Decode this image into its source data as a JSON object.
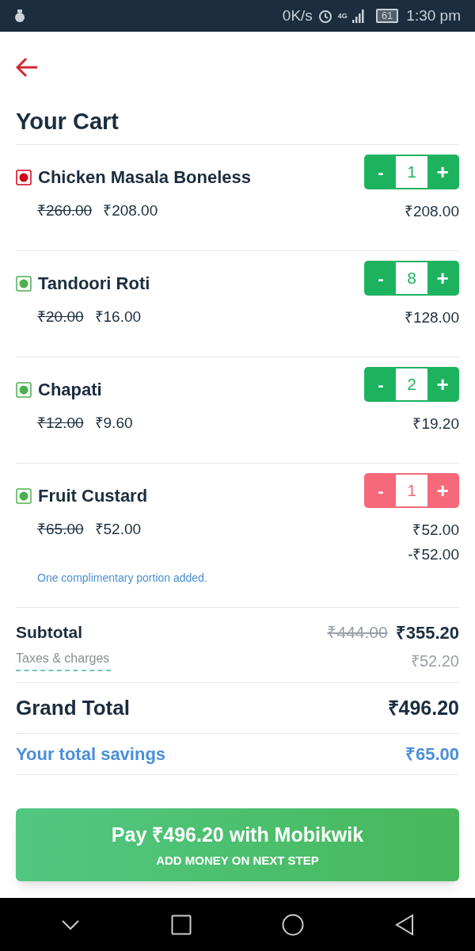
{
  "status_bar": {
    "speed": "0K/s",
    "network": "4G",
    "battery": "61",
    "time": "1:30 pm"
  },
  "title": "Your Cart",
  "items": [
    {
      "name": "Chicken Masala Boneless",
      "kind": "nonveg",
      "original_price": "₹260.00",
      "price": "₹208.00",
      "minus": "-",
      "quantity": "1",
      "plus": "+",
      "total": "₹208.00",
      "complimentary": false
    },
    {
      "name": "Tandoori Roti",
      "kind": "veg",
      "original_price": "₹20.00",
      "price": "₹16.00",
      "minus": "-",
      "quantity": "8",
      "plus": "+",
      "total": "₹128.00",
      "complimentary": false
    },
    {
      "name": "Chapati",
      "kind": "veg",
      "original_price": "₹12.00",
      "price": "₹9.60",
      "minus": "-",
      "quantity": "2",
      "plus": "+",
      "total": "₹19.20",
      "complimentary": false
    },
    {
      "name": "Fruit Custard",
      "kind": "veg",
      "original_price": "₹65.00",
      "price": "₹52.00",
      "minus": "-",
      "quantity": "1",
      "plus": "+",
      "total": "₹52.00",
      "complimentary": true,
      "note": "One complimentary portion added.",
      "discount": "-₹52.00"
    }
  ],
  "summary": {
    "subtotal_label": "Subtotal",
    "subtotal_original": "₹444.00",
    "subtotal": "₹355.20",
    "taxes_label": "Taxes & charges",
    "taxes": "₹52.20",
    "grand_total_label": "Grand Total",
    "grand_total": "₹496.20",
    "savings_label": "Your total savings",
    "savings": "₹65.00"
  },
  "pay_button": {
    "title": "Pay ₹496.20 with Mobikwik",
    "subtitle": "ADD MONEY ON NEXT STEP"
  }
}
